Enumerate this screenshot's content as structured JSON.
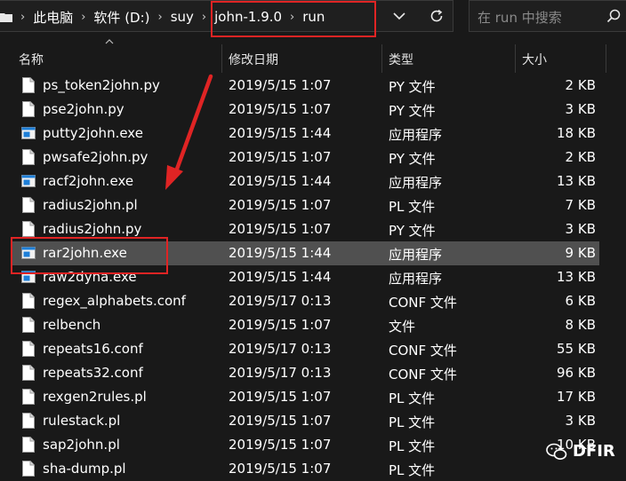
{
  "address": {
    "crumbs": [
      "此电脑",
      "软件 (D:)",
      "suy",
      "john-1.9.0",
      "run"
    ],
    "separator": "›"
  },
  "search": {
    "placeholder": "在 run 中搜索"
  },
  "columns": {
    "name": "名称",
    "date": "修改日期",
    "type": "类型",
    "size": "大小"
  },
  "files": [
    {
      "name": "ps_token2john.py",
      "date": "2019/5/15 1:07",
      "type": "PY 文件",
      "size": "2 KB",
      "icon": "document-icon"
    },
    {
      "name": "pse2john.py",
      "date": "2019/5/15 1:07",
      "type": "PY 文件",
      "size": "3 KB",
      "icon": "document-icon"
    },
    {
      "name": "putty2john.exe",
      "date": "2019/5/15 1:44",
      "type": "应用程序",
      "size": "18 KB",
      "icon": "exe-icon"
    },
    {
      "name": "pwsafe2john.py",
      "date": "2019/5/15 1:07",
      "type": "PY 文件",
      "size": "2 KB",
      "icon": "document-icon"
    },
    {
      "name": "racf2john.exe",
      "date": "2019/5/15 1:44",
      "type": "应用程序",
      "size": "13 KB",
      "icon": "exe-icon"
    },
    {
      "name": "radius2john.pl",
      "date": "2019/5/15 1:07",
      "type": "PL 文件",
      "size": "7 KB",
      "icon": "document-icon"
    },
    {
      "name": "radius2john.py",
      "date": "2019/5/15 1:07",
      "type": "PY 文件",
      "size": "3 KB",
      "icon": "document-icon"
    },
    {
      "name": "rar2john.exe",
      "date": "2019/5/15 1:44",
      "type": "应用程序",
      "size": "9 KB",
      "icon": "exe-icon",
      "selected": true
    },
    {
      "name": "raw2dyna.exe",
      "date": "2019/5/15 1:44",
      "type": "应用程序",
      "size": "13 KB",
      "icon": "exe-icon"
    },
    {
      "name": "regex_alphabets.conf",
      "date": "2019/5/17 0:13",
      "type": "CONF 文件",
      "size": "6 KB",
      "icon": "document-icon"
    },
    {
      "name": "relbench",
      "date": "2019/5/15 1:07",
      "type": "文件",
      "size": "8 KB",
      "icon": "document-icon"
    },
    {
      "name": "repeats16.conf",
      "date": "2019/5/17 0:13",
      "type": "CONF 文件",
      "size": "55 KB",
      "icon": "document-icon"
    },
    {
      "name": "repeats32.conf",
      "date": "2019/5/17 0:13",
      "type": "CONF 文件",
      "size": "96 KB",
      "icon": "document-icon"
    },
    {
      "name": "rexgen2rules.pl",
      "date": "2019/5/15 1:07",
      "type": "PL 文件",
      "size": "17 KB",
      "icon": "document-icon"
    },
    {
      "name": "rulestack.pl",
      "date": "2019/5/15 1:07",
      "type": "PL 文件",
      "size": "3 KB",
      "icon": "document-icon"
    },
    {
      "name": "sap2john.pl",
      "date": "2019/5/15 1:07",
      "type": "PL 文件",
      "size": "10 KB",
      "icon": "document-icon"
    },
    {
      "name": "sha-dump.pl",
      "date": "2019/5/15 1:07",
      "type": "PL 文件",
      "size": "",
      "icon": "document-icon"
    }
  ],
  "watermark": {
    "text": "DFIR"
  },
  "colors": {
    "background": "#191919",
    "selection": "#505050",
    "annotation_red": "#e02424",
    "exe_blue": "#1e7fd8"
  }
}
